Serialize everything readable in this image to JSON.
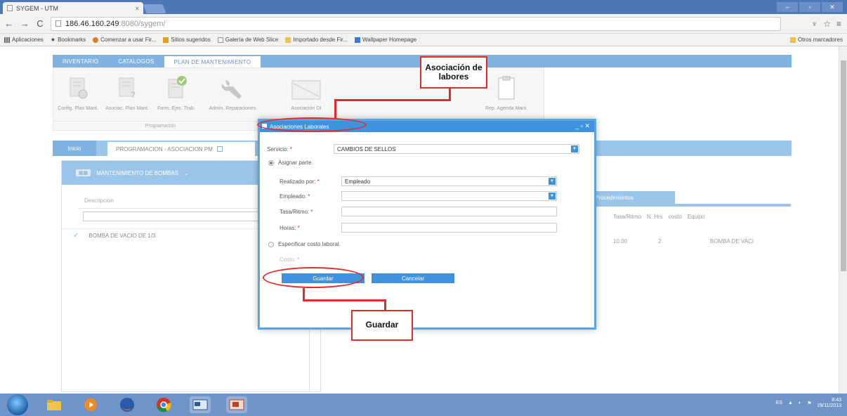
{
  "browser": {
    "tab_title": "SYGEM - UTM",
    "tab_close": "×",
    "url_host": "186.46.160.249",
    "url_path": ":8080/sygem/",
    "bookmarks": [
      "Aplicaciones",
      "Bookmarks",
      "Comenzar a usar Fir...",
      "Sitios sugeridos",
      "Galería de Web Slice",
      "Importado desde Fir...",
      "Wallpaper Homepage"
    ],
    "other_bookmarks": "Otros marcadores"
  },
  "app": {
    "main_tabs": [
      "INVENTARIO",
      "CATALOGOS",
      "PLAN DE MANTENIMIENTO"
    ],
    "ribbon": {
      "items": [
        "Config. Plan Mant.",
        "Asociac. Plan Mant.",
        "Form. Ejec. Trab.",
        "Admin. Reparaciones",
        "Asociación OI",
        "Rep. Agenda Mant."
      ],
      "group_caption": "Programación"
    },
    "subtabs": [
      "Inicio",
      "PROGRAMACION - ASOCIACION PM"
    ],
    "left_panel": {
      "header": "MANTENIMIENTO DE BOMBAS",
      "column": "Descripcion",
      "row": "BOMBA DE VACIO DE 1/3"
    },
    "right_panel": {
      "tab": "Procedimientos",
      "headers": [
        "Tasa/Ritmo",
        "N. Hrs",
        "costo",
        "Equipo"
      ],
      "row": [
        "10.00",
        "2",
        "",
        "BOMBA DE VACI"
      ]
    }
  },
  "dialog": {
    "title": "Asociaciones Laborales",
    "controls": "_ ▫ ✕",
    "servicio_label": "Servicio:",
    "servicio_value": "CAMBIOS DE SELLOS",
    "asignar_label": "Asignar parte.",
    "realizado_label": "Realizado por:",
    "realizado_value": "Empleado",
    "empleado_label": "Empleado:",
    "tasa_label": "Tasa/Ritmo:",
    "horas_label": "Horas:",
    "especificar_label": "Especificar costo laboral.",
    "costo_label": "Costo:",
    "required_mark": "*",
    "guardar": "Guardar",
    "cancelar": "Cancelar"
  },
  "annotations": {
    "top": "Asociación de labores",
    "bottom": "Guardar"
  },
  "taskbar": {
    "time": "8:43",
    "date": "29/11/2013"
  },
  "colors": {
    "accent": "#3f92de",
    "annotation": "#e62a2a",
    "taskbar": "#6f95c8"
  }
}
